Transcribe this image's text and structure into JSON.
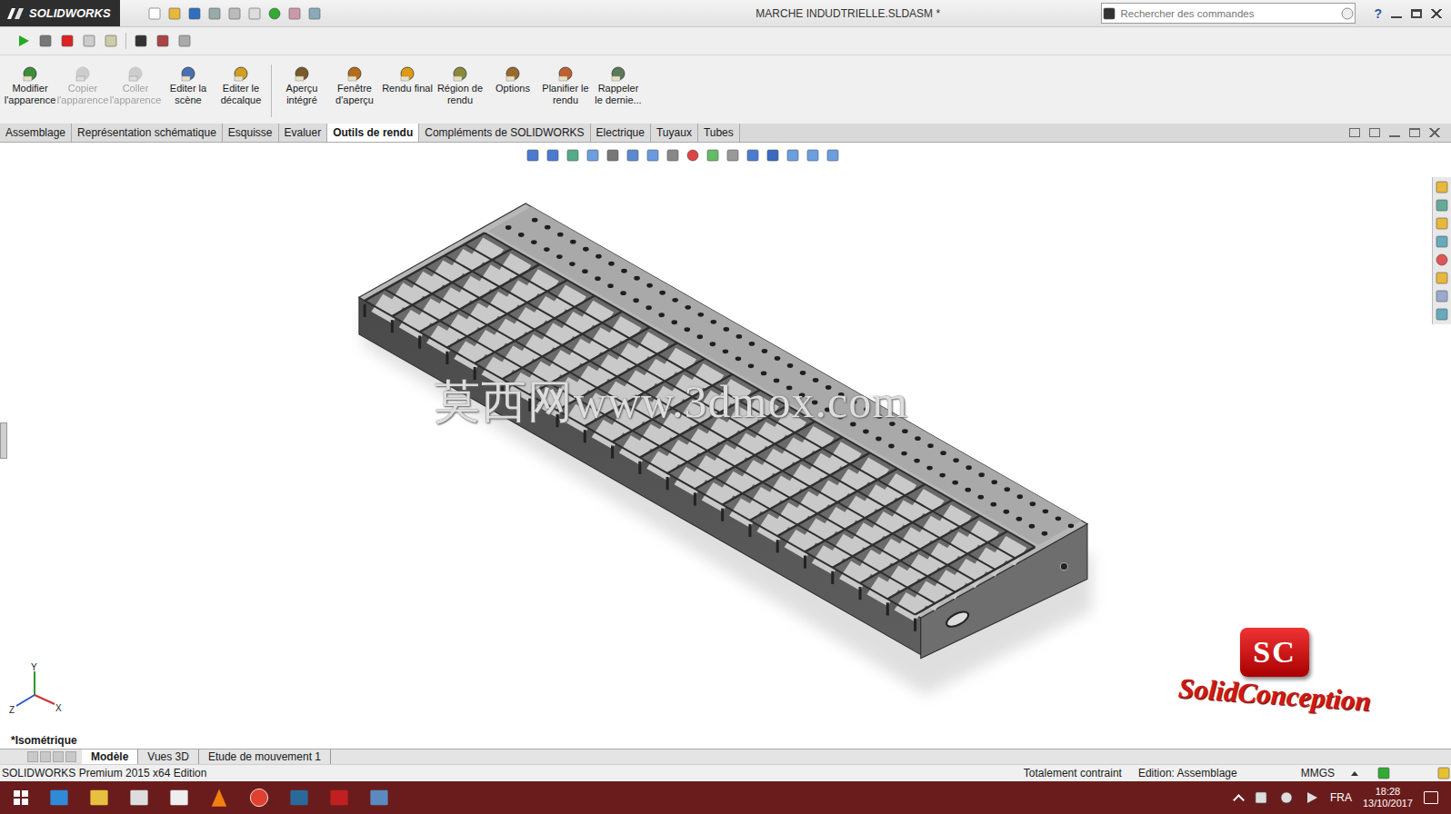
{
  "window": {
    "app": "SOLIDWORKS",
    "title": "MARCHE INDUDTRIELLE.SLDASM *"
  },
  "search": {
    "placeholder": "Rechercher des commandes"
  },
  "help": "?",
  "ribbon": [
    {
      "label": "Modifier l'apparence",
      "disabled": false
    },
    {
      "label": "Copier l'apparence",
      "disabled": true
    },
    {
      "label": "Coller l'apparence",
      "disabled": true
    },
    {
      "label": "Editer la scène",
      "disabled": false
    },
    {
      "label": "Editer le décalque",
      "disabled": false
    },
    {
      "label": "Aperçu intégré",
      "disabled": false
    },
    {
      "label": "Fenêtre d'aperçu",
      "disabled": false
    },
    {
      "label": "Rendu final",
      "disabled": false
    },
    {
      "label": "Région de rendu",
      "disabled": false
    },
    {
      "label": "Options",
      "disabled": false
    },
    {
      "label": "Planifier le rendu",
      "disabled": false
    },
    {
      "label": "Rappeler le dernie...",
      "disabled": false
    }
  ],
  "tabs": [
    {
      "label": "Assemblage",
      "selected": false
    },
    {
      "label": "Représentation schématique",
      "selected": false
    },
    {
      "label": "Esquisse",
      "selected": false
    },
    {
      "label": "Evaluer",
      "selected": false
    },
    {
      "label": "Outils de rendu",
      "selected": true
    },
    {
      "label": "Compléments de SOLIDWORKS",
      "selected": false
    },
    {
      "label": "Electrique",
      "selected": false
    },
    {
      "label": "Tuyaux",
      "selected": false
    },
    {
      "label": "Tubes",
      "selected": false
    }
  ],
  "viewport": {
    "view_label": "*Isométrique",
    "watermark": "莫西网www.3dmox.com",
    "logo": {
      "badge": "SC",
      "text": "SolidConception"
    },
    "axes": [
      "Y",
      "X",
      "Z"
    ]
  },
  "bottom_tabs": [
    {
      "label": "Modèle",
      "selected": true
    },
    {
      "label": "Vues 3D",
      "selected": false
    },
    {
      "label": "Etude de mouvement 1",
      "selected": false
    }
  ],
  "status_bar": [
    "SOLIDWORKS Premium 2015 x64 Edition",
    "Totalement contraint",
    "Edition: Assemblage",
    "MMGS"
  ],
  "taskbar": {
    "language": "FRA",
    "time": "18:28",
    "date": "13/10/2017"
  }
}
